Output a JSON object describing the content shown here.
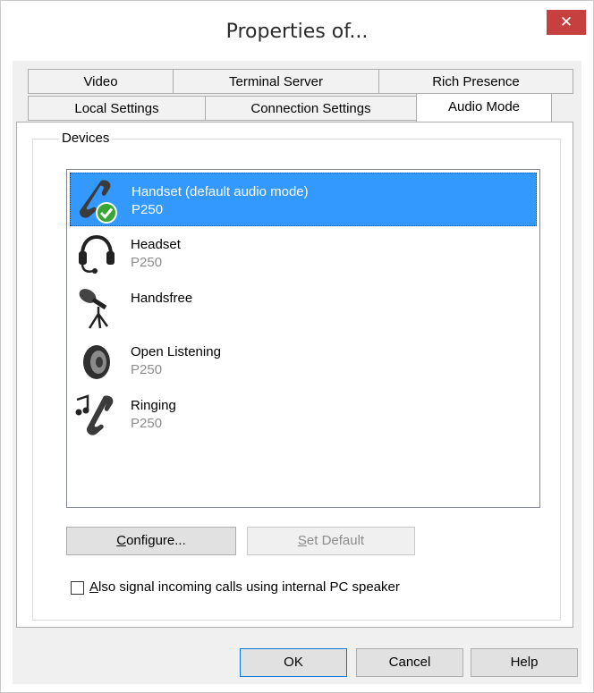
{
  "window": {
    "title": "Properties of...",
    "close_glyph": "✕"
  },
  "tabs": {
    "row_top": [
      {
        "label": "Video"
      },
      {
        "label": "Terminal Server"
      },
      {
        "label": "Rich Presence"
      }
    ],
    "row_bottom": [
      {
        "label": "Local Settings"
      },
      {
        "label": "Connection Settings"
      },
      {
        "label": "Audio Mode",
        "active": true
      }
    ]
  },
  "devices": {
    "group_label": "Devices",
    "items": [
      {
        "name": "Handset (default audio mode)",
        "sub": "P250",
        "icon": "handset-default-icon",
        "selected": true
      },
      {
        "name": "Headset",
        "sub": "P250",
        "icon": "headset-icon"
      },
      {
        "name": "Handsfree",
        "sub": "",
        "icon": "microphone-icon"
      },
      {
        "name": "Open Listening",
        "sub": "P250",
        "icon": "speaker-icon"
      },
      {
        "name": "Ringing",
        "sub": "P250",
        "icon": "ringing-icon"
      }
    ]
  },
  "buttons": {
    "configure": {
      "label_prefix": "",
      "label_u": "C",
      "label_rest": "onfigure..."
    },
    "set_default": {
      "label_u": "S",
      "label_rest": "et Default"
    }
  },
  "checkbox": {
    "label_u": "A",
    "label_rest": "lso signal incoming calls using internal PC speaker",
    "checked": false
  },
  "footer": {
    "ok": "OK",
    "cancel": "Cancel",
    "help": "Help"
  },
  "colors": {
    "selection": "#3399ff",
    "close": "#c74040",
    "dimmed": "#8c8c8c"
  }
}
